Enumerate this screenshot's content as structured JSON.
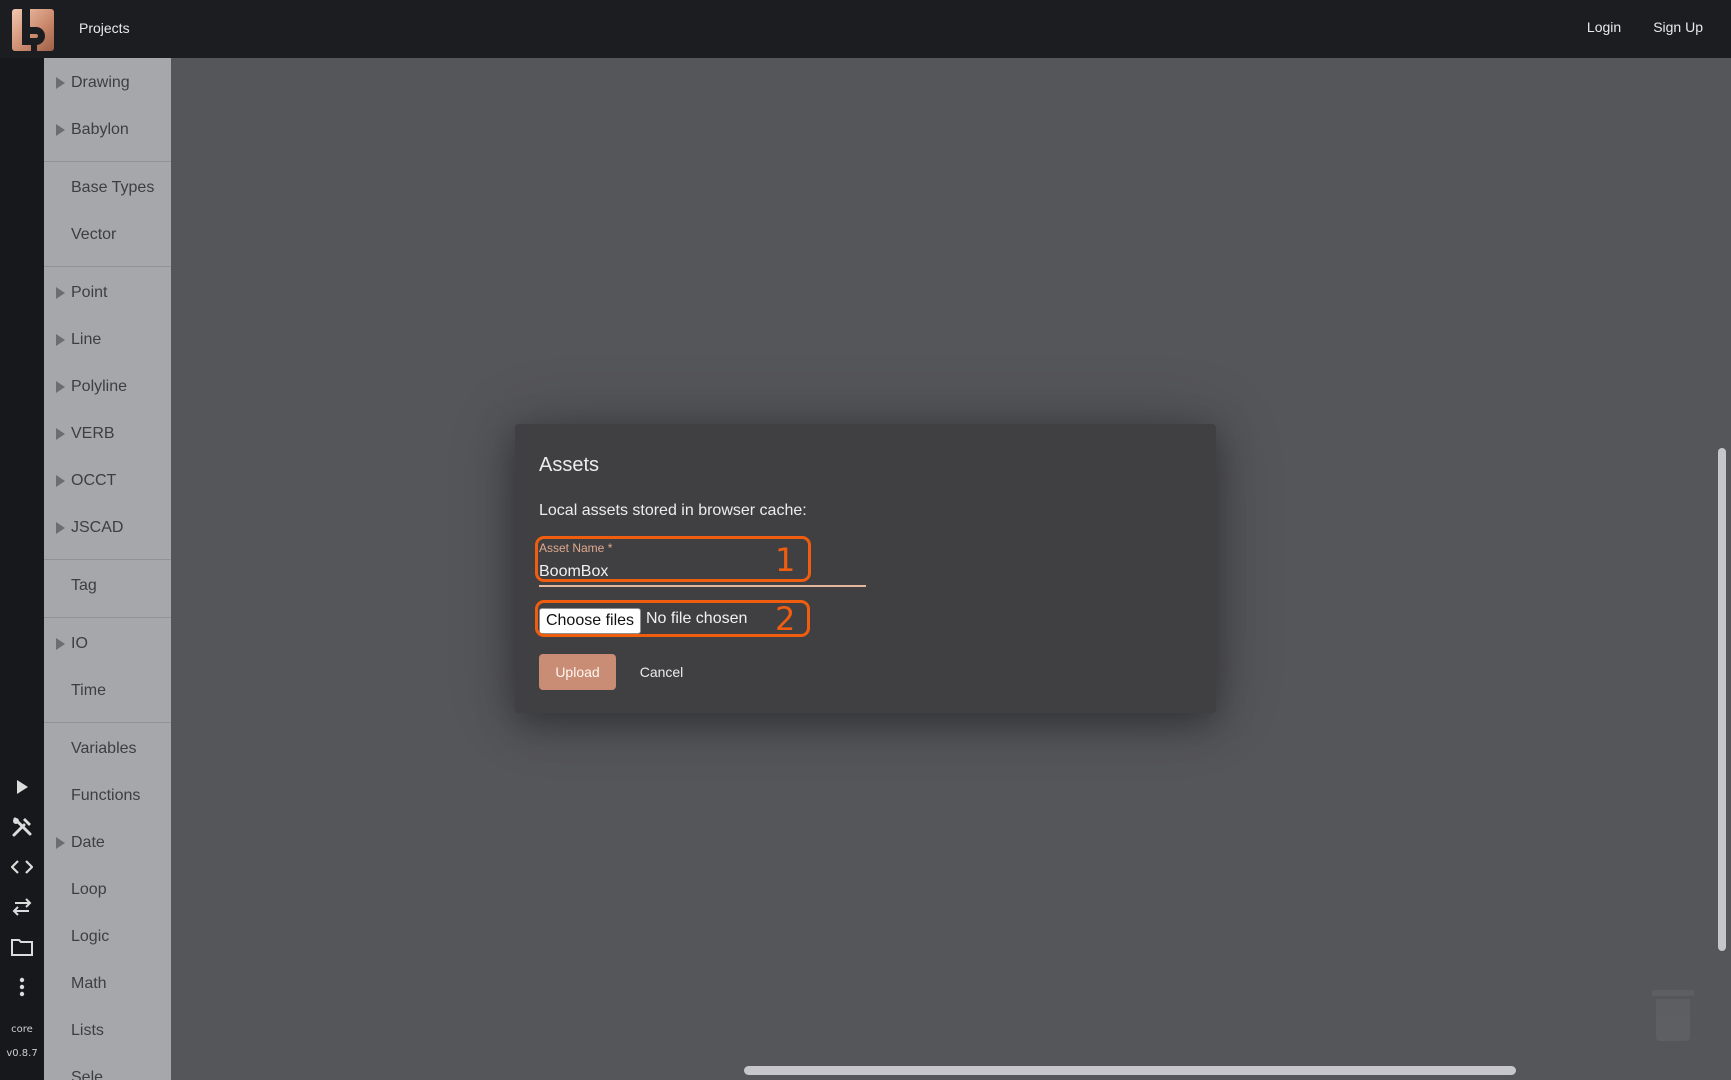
{
  "topbar": {
    "projects_label": "Projects",
    "login_label": "Login",
    "signup_label": "Sign Up"
  },
  "rail": {
    "core_label": "core",
    "version_label": "v0.8.7"
  },
  "categories": [
    {
      "label": "Drawing",
      "expandable": true
    },
    {
      "label": "Babylon",
      "expandable": true
    },
    {
      "label": "Base Types",
      "expandable": false
    },
    {
      "label": "Vector",
      "expandable": false
    },
    {
      "label": "Point",
      "expandable": true
    },
    {
      "label": "Line",
      "expandable": true
    },
    {
      "label": "Polyline",
      "expandable": true
    },
    {
      "label": "VERB",
      "expandable": true
    },
    {
      "label": "OCCT",
      "expandable": true
    },
    {
      "label": "JSCAD",
      "expandable": true
    },
    {
      "label": "Tag",
      "expandable": false
    },
    {
      "label": "IO",
      "expandable": true
    },
    {
      "label": "Time",
      "expandable": false
    },
    {
      "label": "Variables",
      "expandable": false
    },
    {
      "label": "Functions",
      "expandable": false
    },
    {
      "label": "Date",
      "expandable": true
    },
    {
      "label": "Loop",
      "expandable": false
    },
    {
      "label": "Logic",
      "expandable": false
    },
    {
      "label": "Math",
      "expandable": false
    },
    {
      "label": "Lists",
      "expandable": false
    },
    {
      "label": "Sele",
      "expandable": false
    }
  ],
  "dialog": {
    "title": "Assets",
    "description": "Local assets stored in browser cache:",
    "asset_name_label": "Asset Name *",
    "asset_name_value": "BoomBox",
    "choose_files_label": "Choose files",
    "no_file_text": "No file chosen",
    "upload_label": "Upload",
    "cancel_label": "Cancel"
  },
  "annotations": {
    "marker_1": "1",
    "marker_2": "2"
  },
  "colors": {
    "accent": "#c98c74",
    "annotation": "#f05d0e",
    "topbar": "#1b1d21",
    "sidebar": "#a6a7aa",
    "workspace": "#55565a",
    "dialog": "#404043"
  }
}
